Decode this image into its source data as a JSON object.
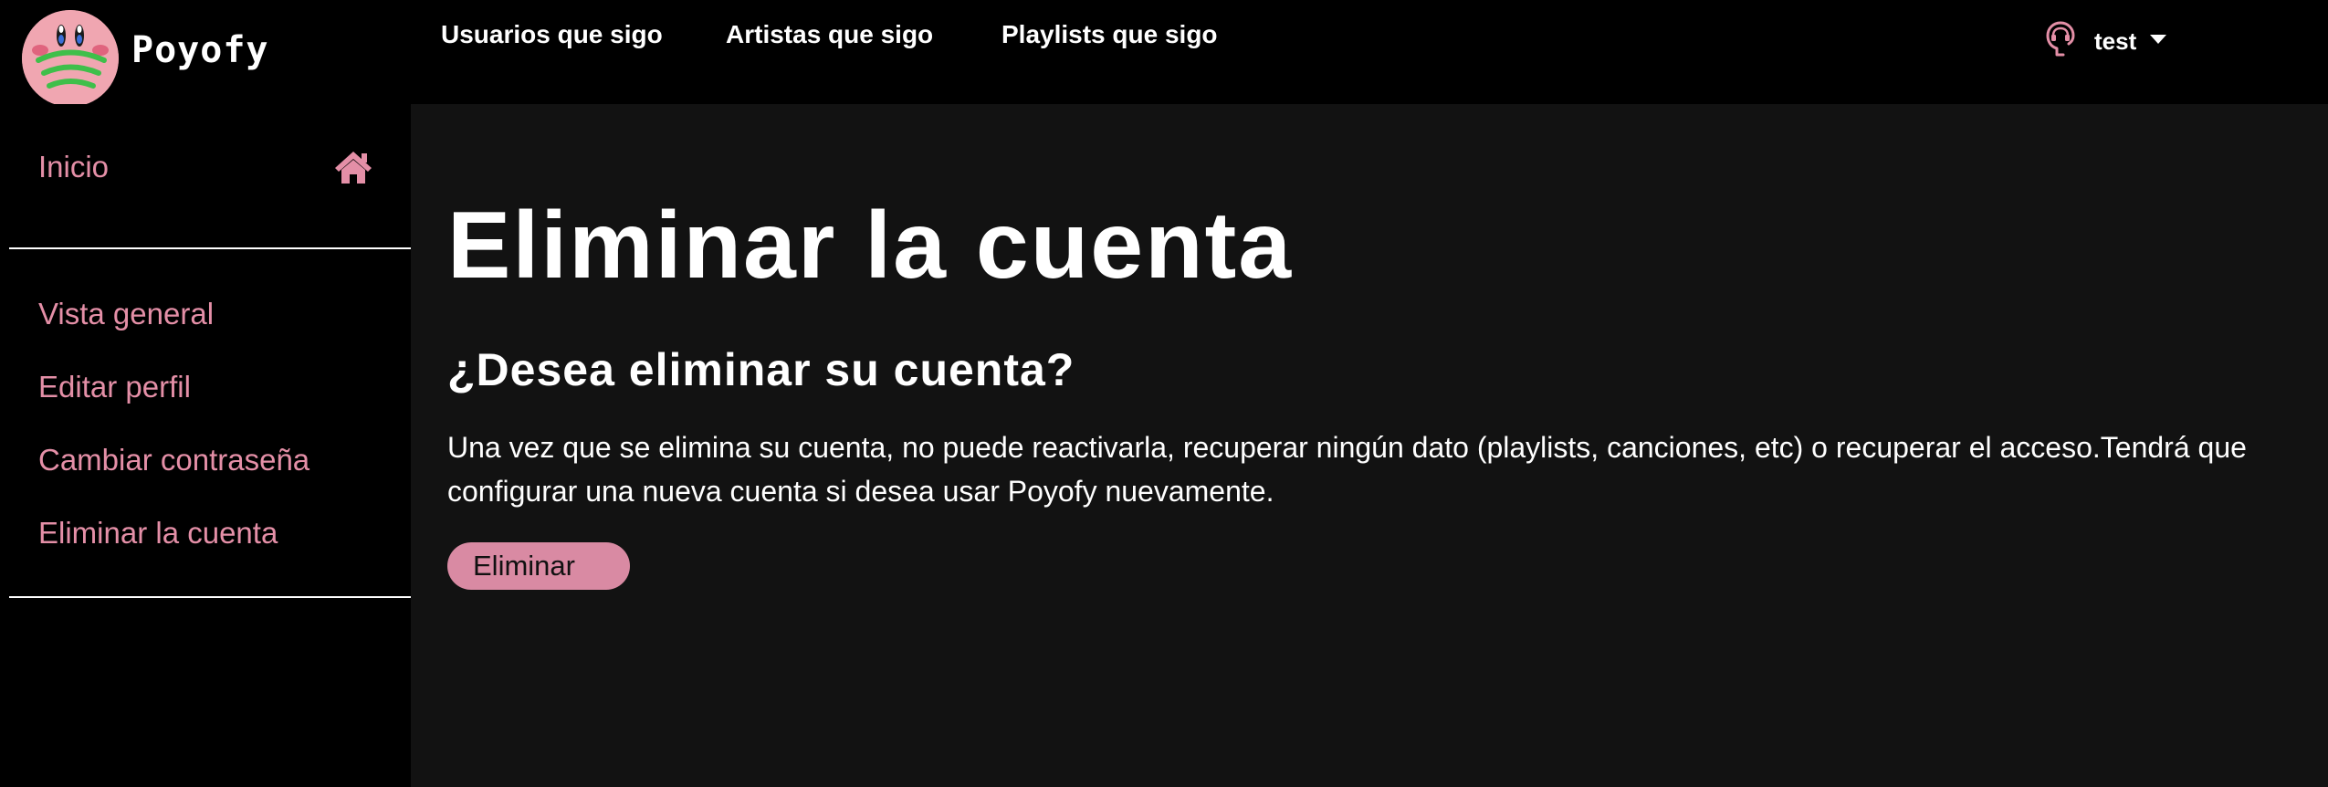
{
  "app": {
    "brand_name": "Poyofy"
  },
  "topnav": {
    "items": [
      {
        "label": "Usuarios que sigo"
      },
      {
        "label": "Artistas que sigo"
      },
      {
        "label": "Playlists que sigo"
      }
    ],
    "user": {
      "name": "test",
      "icon": "user-headphones-icon",
      "dropdown_icon": "caret-down-icon"
    }
  },
  "sidebar": {
    "home": {
      "label": "Inicio",
      "icon": "home-icon"
    },
    "items": [
      {
        "label": "Vista general"
      },
      {
        "label": "Editar perfil"
      },
      {
        "label": "Cambiar contraseña"
      },
      {
        "label": "Eliminar la cuenta"
      }
    ]
  },
  "main": {
    "title": "Eliminar la cuenta",
    "subtitle": "¿Desea eliminar su cuenta?",
    "description": "Una vez que se elimina su cuenta, no puede reactivarla, recuperar ningún dato (playlists, canciones, etc) o recuperar el acceso.Tendrá que configurar una nueva cuenta si desea usar Poyofy nuevamente.",
    "delete_button": "Eliminar"
  },
  "colors": {
    "accent_pink": "#e48fa7",
    "button_pink": "#d98aa3",
    "main_bg": "#121212",
    "chrome_bg": "#000000",
    "logo_pink": "#f0a6b1",
    "logo_green": "#3fbf4a"
  }
}
